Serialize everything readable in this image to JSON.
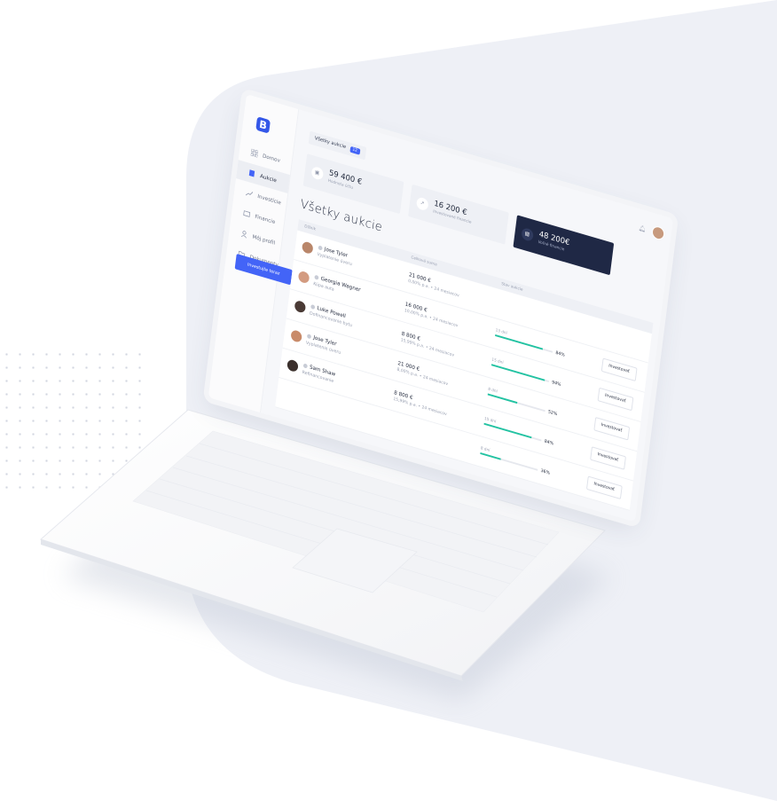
{
  "colors": {
    "accent": "#4364f7",
    "dark_card": "#1f2845",
    "progress": "#22c3a2",
    "background_shape": "#eef0f6"
  },
  "app": {
    "logo_letter": "B",
    "tab_label": "Všetky aukcie",
    "tab_count": "12"
  },
  "sidebar": {
    "items": [
      {
        "label": "Domov",
        "icon": "grid-icon"
      },
      {
        "label": "Aukcie",
        "icon": "building-icon"
      },
      {
        "label": "Investície",
        "icon": "trend-icon"
      },
      {
        "label": "Financie",
        "icon": "wallet-icon"
      },
      {
        "label": "Môj profil",
        "icon": "user-icon"
      },
      {
        "label": "Dokumenty",
        "icon": "folder-icon"
      }
    ],
    "cta_label": "Investujte teraz"
  },
  "cards": [
    {
      "value": "59 400 €",
      "label": "Hodnota účtu",
      "icon": "wallet-icon"
    },
    {
      "value": "16 200 €",
      "label": "Investované financie",
      "icon": "trend-icon"
    },
    {
      "value": "48 200€",
      "label": "Voľné financie",
      "icon": "card-icon"
    }
  ],
  "page_title": "Všetky aukcie",
  "table": {
    "headers": [
      "Dlžník",
      "Celková suma",
      "Stav aukcie",
      ""
    ],
    "rows": [
      {
        "name": "Jose Tyler",
        "purpose": "Vyplatenie úveru",
        "amount": "21 000 €",
        "terms": "0,00% p.a. • 24 mesiacov",
        "days": "",
        "percent": "",
        "progress": 0,
        "button": ""
      },
      {
        "name": "Georgia Wagner",
        "purpose": "Kúpa auta",
        "amount": "16 000 €",
        "terms": "10,00% p.a. • 24 mesiacov",
        "days": "13 dní",
        "percent": "84%",
        "progress": 84,
        "button": "Investovať"
      },
      {
        "name": "Luke Powell",
        "purpose": "Dofinancovanie bytu",
        "amount": "8 800 €",
        "terms": "15,99% p.a. • 24 mesiacov",
        "days": "15 dní",
        "percent": "94%",
        "progress": 94,
        "button": "Investovať"
      },
      {
        "name": "Jose Tyler",
        "purpose": "Vyplatenie úveru",
        "amount": "21 000 €",
        "terms": "8,00% p.a. • 24 mesiacov",
        "days": "8 dní",
        "percent": "52%",
        "progress": 52,
        "button": "Investovať"
      },
      {
        "name": "Sam Shaw",
        "purpose": "Refinancovanie",
        "amount": "8 800 €",
        "terms": "15,99% p.a. • 24 mesiacov",
        "days": "15 dní",
        "percent": "84%",
        "progress": 84,
        "button": "Investovať"
      }
    ],
    "extra_row": {
      "days": "8 dní",
      "percent": "36%",
      "progress": 36,
      "button": "Investovať"
    }
  }
}
